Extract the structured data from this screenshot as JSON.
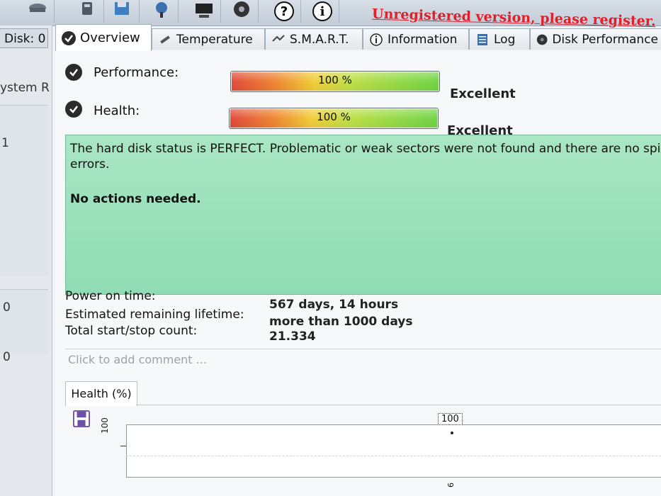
{
  "toolbar": {
    "unregistered_notice": "Unregistered version, please register.",
    "buttons": [
      "settings-icon",
      "disk-icon",
      "save-icon",
      "network-icon",
      "computer-icon",
      "disc-icon",
      "help-icon",
      "info-icon"
    ]
  },
  "left_panel": {
    "disk_label": "Disk: 0",
    "system_label": "ystem R",
    "row1_value": "1",
    "row2_value": "0",
    "row3_value": "0"
  },
  "tabs": [
    {
      "label": "Overview",
      "icon": "check-icon"
    },
    {
      "label": "Temperature",
      "icon": "thermometer-icon"
    },
    {
      "label": "S.M.A.R.T.",
      "icon": "smart-icon"
    },
    {
      "label": "Information",
      "icon": "info-icon"
    },
    {
      "label": "Log",
      "icon": "log-icon"
    },
    {
      "label": "Disk Performance",
      "icon": "disk-performance-icon"
    }
  ],
  "metrics": {
    "performance": {
      "label": "Performance:",
      "value_text": "100 %",
      "value": 100,
      "rating": "Excellent"
    },
    "health": {
      "label": "Health:",
      "value_text": "100 %",
      "value": 100,
      "rating": "Excellent"
    }
  },
  "status": {
    "message": "The hard disk status is PERFECT. Problematic or weak sectors were not found and there are no spi errors.",
    "action": "No actions needed.",
    "color": "#9fe2bd"
  },
  "info": {
    "power_on_label": "Power on time:",
    "power_on_value": "567 days, 14 hours",
    "lifetime_label": "Estimated remaining lifetime:",
    "lifetime_value": "more than 1000 days",
    "startstop_label": "Total start/stop count:",
    "startstop_value": "21.334"
  },
  "comment": {
    "placeholder": "Click to add comment ..."
  },
  "chart": {
    "tab_label": "Health (%)",
    "save_icon": "save-icon"
  },
  "chart_data": {
    "type": "line",
    "title": "Health (%)",
    "ylabel": "",
    "yticks": [
      "100"
    ],
    "series": [
      {
        "values": [
          100
        ]
      }
    ],
    "data_labels": [
      "100"
    ],
    "x_tick_partial": "6"
  }
}
